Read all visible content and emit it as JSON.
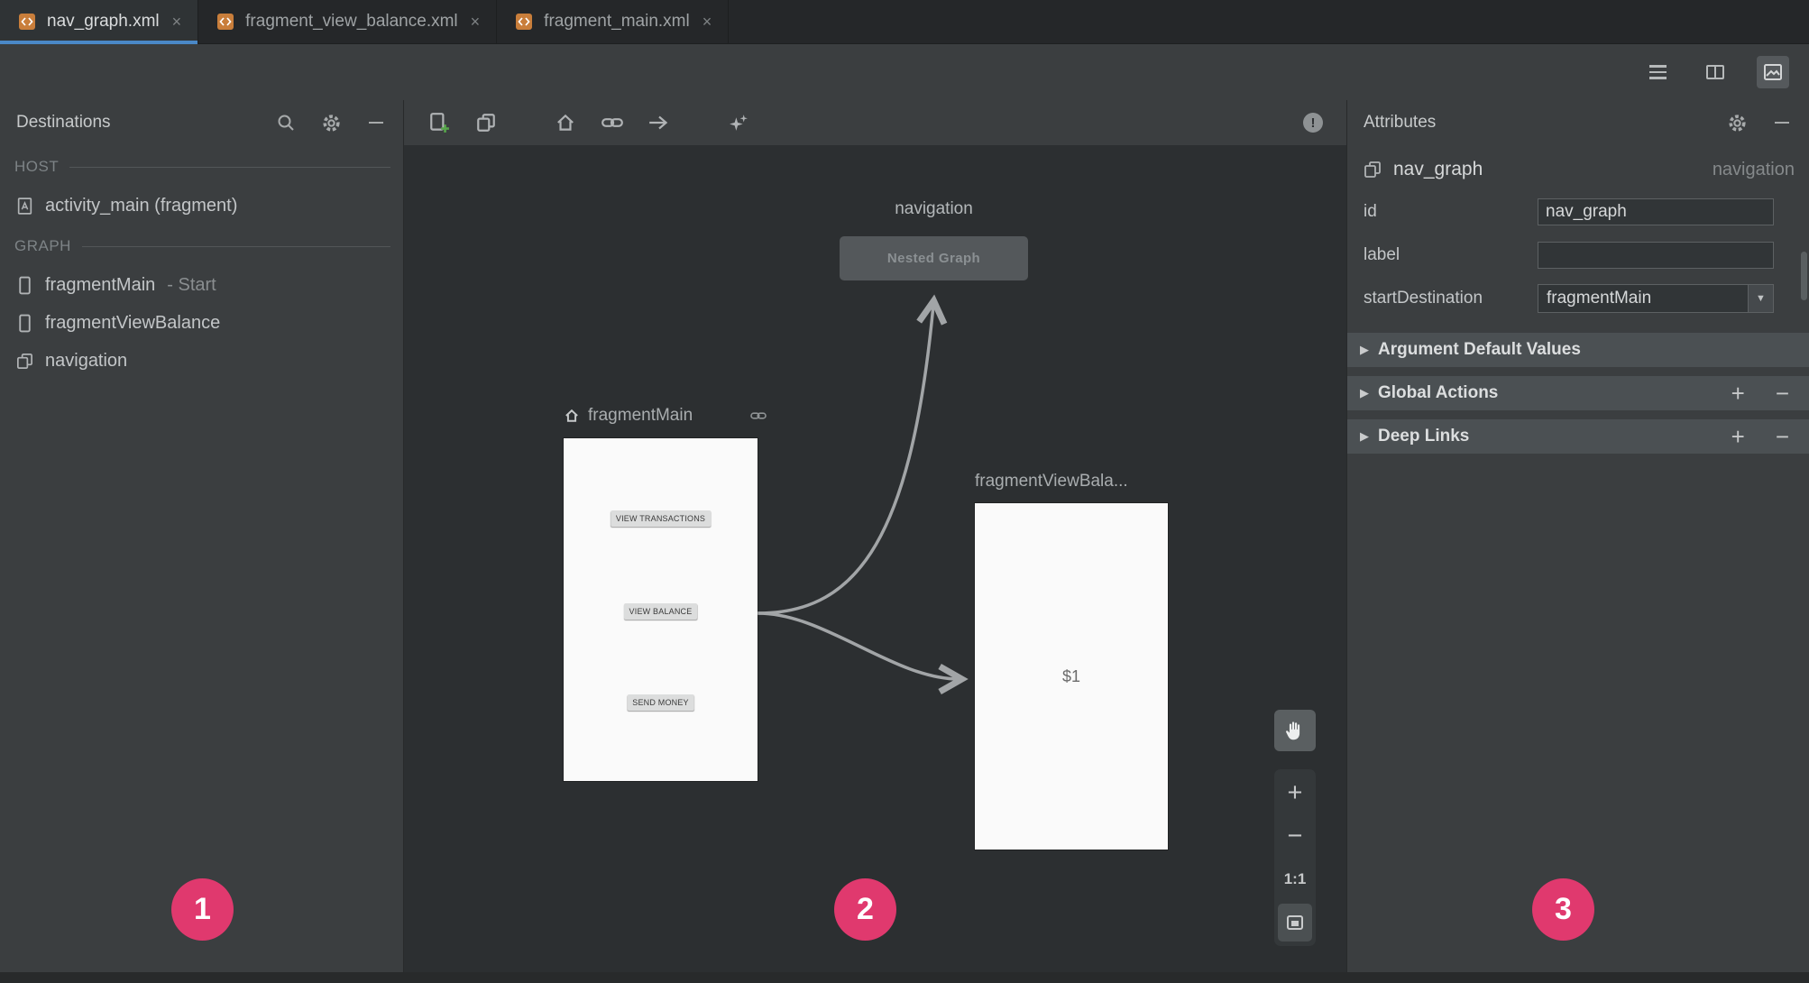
{
  "window": {
    "tabs": [
      {
        "label": "nav_graph.xml",
        "active": true
      },
      {
        "label": "fragment_view_balance.xml",
        "active": false
      },
      {
        "label": "fragment_main.xml",
        "active": false
      }
    ]
  },
  "icons": {
    "close": "×",
    "warning": "!",
    "collapse": "▶",
    "dropdown": "▼",
    "plus": "+",
    "minus": "−"
  },
  "destinations": {
    "title": "Destinations",
    "host_header": "HOST",
    "graph_header": "GRAPH",
    "host_items": [
      {
        "label": "activity_main (fragment)"
      }
    ],
    "graph_items": [
      {
        "label": "fragmentMain",
        "suffix": "- Start"
      },
      {
        "label": "fragmentViewBalance",
        "suffix": ""
      },
      {
        "label": "navigation",
        "suffix": ""
      }
    ]
  },
  "canvas": {
    "nested_graph": {
      "title": "navigation",
      "body": "Nested Graph"
    },
    "fragment_main": {
      "title": "fragmentMain",
      "buttons": [
        "VIEW TRANSACTIONS",
        "VIEW BALANCE",
        "SEND MONEY"
      ]
    },
    "fragment_view_balance": {
      "title": "fragmentViewBala...",
      "body": "$1"
    },
    "zoom": {
      "zoom_in": "+",
      "zoom_out": "−",
      "ratio": "1:1"
    }
  },
  "attributes": {
    "title": "Attributes",
    "component": {
      "name": "nav_graph",
      "type": "navigation"
    },
    "rows": [
      {
        "label": "id",
        "value": "nav_graph"
      },
      {
        "label": "label",
        "value": ""
      },
      {
        "label": "startDestination",
        "value": "fragmentMain"
      }
    ],
    "sections": [
      {
        "label": "Argument Default Values"
      },
      {
        "label": "Global Actions"
      },
      {
        "label": "Deep Links"
      }
    ]
  },
  "badges": {
    "one": "1",
    "two": "2",
    "three": "3"
  },
  "colors": {
    "accent_blue": "#4A88C7",
    "badge_pink": "#E0396E",
    "add_green": "#57A64A",
    "canvas_bg": "#2C2F31",
    "panel_bg": "#3B3E40",
    "frame_white": "#FAFAFA"
  }
}
